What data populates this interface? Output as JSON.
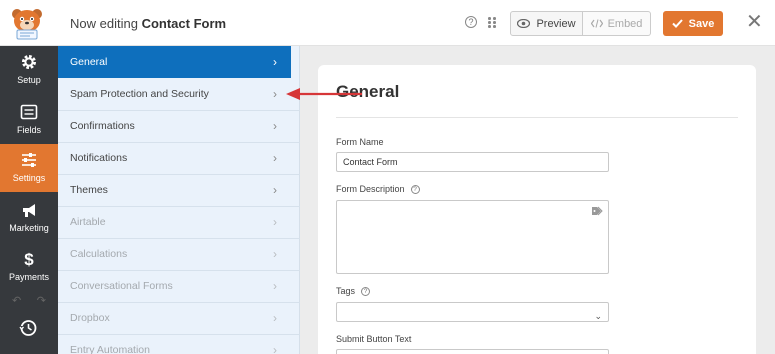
{
  "header": {
    "editing_prefix": "Now editing",
    "form_name": "Contact Form",
    "help_glyph": "?",
    "preview_label": "Preview",
    "embed_label": "Embed",
    "save_label": "Save",
    "close_glyph": "✕"
  },
  "icon_nav": [
    {
      "label": "Setup",
      "icon": "gear-icon"
    },
    {
      "label": "Fields",
      "icon": "list-icon"
    },
    {
      "label": "Settings",
      "icon": "sliders-icon",
      "active": true
    },
    {
      "label": "Marketing",
      "icon": "megaphone-icon"
    },
    {
      "label": "Payments",
      "icon": "dollar-icon"
    }
  ],
  "undo_glyph": "↶",
  "redo_glyph": "↷",
  "settings_panel": {
    "items": [
      {
        "label": "General",
        "state": "active"
      },
      {
        "label": "Spam Protection and Security",
        "state": "normal"
      },
      {
        "label": "Confirmations",
        "state": "normal"
      },
      {
        "label": "Notifications",
        "state": "normal"
      },
      {
        "label": "Themes",
        "state": "normal"
      },
      {
        "label": "Airtable",
        "state": "disabled"
      },
      {
        "label": "Calculations",
        "state": "disabled"
      },
      {
        "label": "Conversational Forms",
        "state": "disabled"
      },
      {
        "label": "Dropbox",
        "state": "disabled"
      },
      {
        "label": "Entry Automation",
        "state": "disabled"
      }
    ],
    "chevron": "›"
  },
  "main": {
    "title": "General",
    "form_name_label": "Form Name",
    "form_name_value": "Contact Form",
    "form_description_label": "Form Description",
    "form_description_value": "",
    "tags_label": "Tags",
    "tags_value": "",
    "submit_button_text_label": "Submit Button Text",
    "qmark": "?",
    "select_chevron": "⌄"
  },
  "colors": {
    "accent": "#e27730",
    "active_item": "#0e6fbd",
    "nav_bg": "#36393d",
    "panel_bg": "#eaf2fb",
    "annotation_arrow": "#d63638"
  }
}
